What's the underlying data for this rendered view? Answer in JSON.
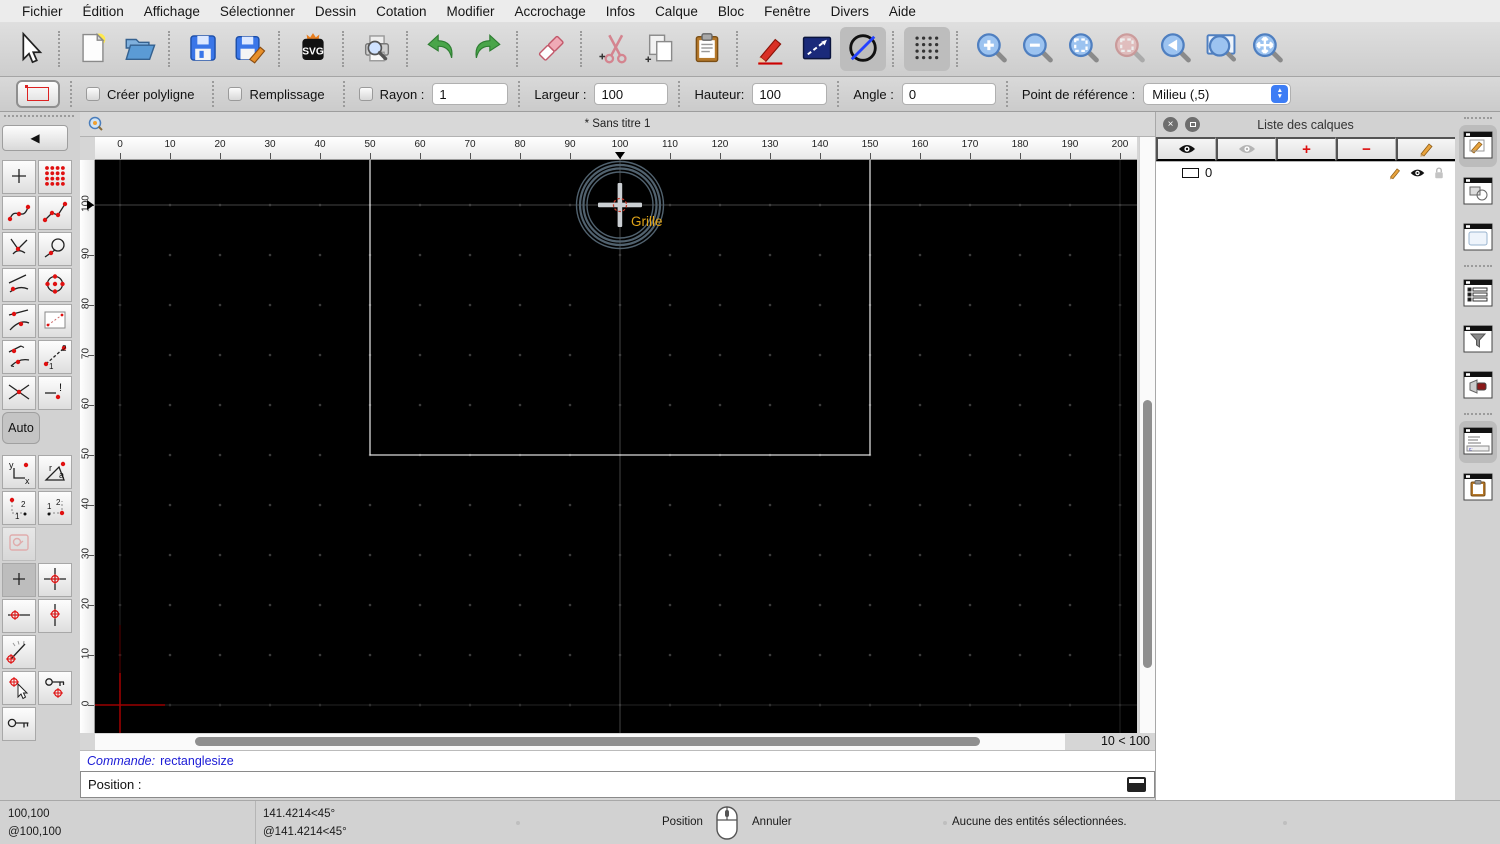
{
  "menu": {
    "items": [
      "Fichier",
      "Édition",
      "Affichage",
      "Sélectionner",
      "Dessin",
      "Cotation",
      "Modifier",
      "Accrochage",
      "Infos",
      "Calque",
      "Bloc",
      "Fenêtre",
      "Divers",
      "Aide"
    ]
  },
  "toolbar": {
    "buttons": [
      "cursor",
      "|",
      "new-document",
      "open-file",
      "|",
      "save",
      "save-as",
      "|",
      "svg-export",
      "|",
      "print-preview",
      "|",
      "undo",
      "redo",
      "|",
      "delete-entity",
      "|",
      "cut",
      "copy",
      "paste",
      "|",
      "draw-pen",
      "polyline-tool",
      "circle-line-toggle:on",
      "|",
      "grid-toggle:on",
      "|",
      "zoom-in",
      "zoom-out",
      "zoom-auto",
      "zoom-selection:disabled",
      "zoom-previous",
      "zoom-window",
      "zoom-pan"
    ]
  },
  "tool_options": {
    "polyline_label": "Créer polyligne",
    "fill_label": "Remplissage",
    "radius_label": "Rayon :",
    "radius_value": "1",
    "width_label": "Largeur :",
    "width_value": "100",
    "height_label": "Hauteur:",
    "height_value": "100",
    "angle_label": "Angle :",
    "angle_value": "0",
    "refpoint_label": "Point de référence :",
    "refpoint_value": "Milieu (,5)"
  },
  "left_dock": {
    "auto_label": "Auto",
    "back_icon": "chevron-left",
    "rows": [
      [
        "point-plus",
        "points-grid"
      ],
      [
        "spline-points",
        "polyline-points"
      ],
      [
        "tangent-point",
        "circle-tangent"
      ],
      [
        "arc-point",
        "circle-center"
      ],
      [
        "tangent-line",
        "rect-diagonal"
      ],
      [
        "tangent-two",
        "line-seq"
      ],
      [
        "intersection",
        "line-manual"
      ],
      "AUTO",
      [
        "coords-xy",
        "polar-ra"
      ],
      [
        "corner-12",
        "corner-21"
      ],
      [
        "rect-red:disabled"
      ],
      [
        "plus:on",
        "crosshair-target"
      ],
      [
        "target-horizontal",
        "target-vertical"
      ],
      [
        "gauge"
      ],
      [
        "cursor-target",
        "key-target"
      ],
      [
        "key"
      ]
    ]
  },
  "document": {
    "title": "* Sans titre 1"
  },
  "rulers": {
    "horizontal": [
      "0",
      "10",
      "20",
      "30",
      "40",
      "50",
      "60",
      "70",
      "80",
      "90",
      "100",
      "110",
      "120",
      "130",
      "140",
      "150",
      "160",
      "170",
      "180",
      "190",
      "200"
    ],
    "vertical": [
      "100",
      "90",
      "80",
      "70",
      "60",
      "50",
      "40",
      "30",
      "20",
      "10",
      "0"
    ]
  },
  "canvas": {
    "snap_label": "Grille",
    "zoom_indicator": "10 < 100"
  },
  "command_panel": {
    "history_prefix": "Commande:",
    "history_text": "rectanglesize",
    "position_label": "Position :"
  },
  "layers_panel": {
    "title": "Liste des calques",
    "layers": [
      {
        "name": "0"
      }
    ]
  },
  "right_strip": {
    "buttons": [
      "layers:on",
      "blocks",
      "library",
      "|",
      "entities",
      "filter",
      "hatch",
      "|",
      "command:on",
      "clipboard"
    ]
  },
  "status": {
    "abs_coord": "100,100",
    "rel_coord": "@100,100",
    "abs_polar": "141.4214<45°",
    "rel_polar": "@141.4214<45°",
    "left_button_label": "Position",
    "right_button_label": "Annuler",
    "selection_status": "Aucune des entités sélectionnées."
  },
  "colors": {
    "accent": "#3d7df5",
    "command_text": "#1b1bd6",
    "snap_label": "#e0a418",
    "canvas_bg": "#000000",
    "entity": "#d9d9d9",
    "origin": "#9a0000",
    "grid_dot": "#3c3c3c",
    "crosshair_ring": "#51626f"
  }
}
